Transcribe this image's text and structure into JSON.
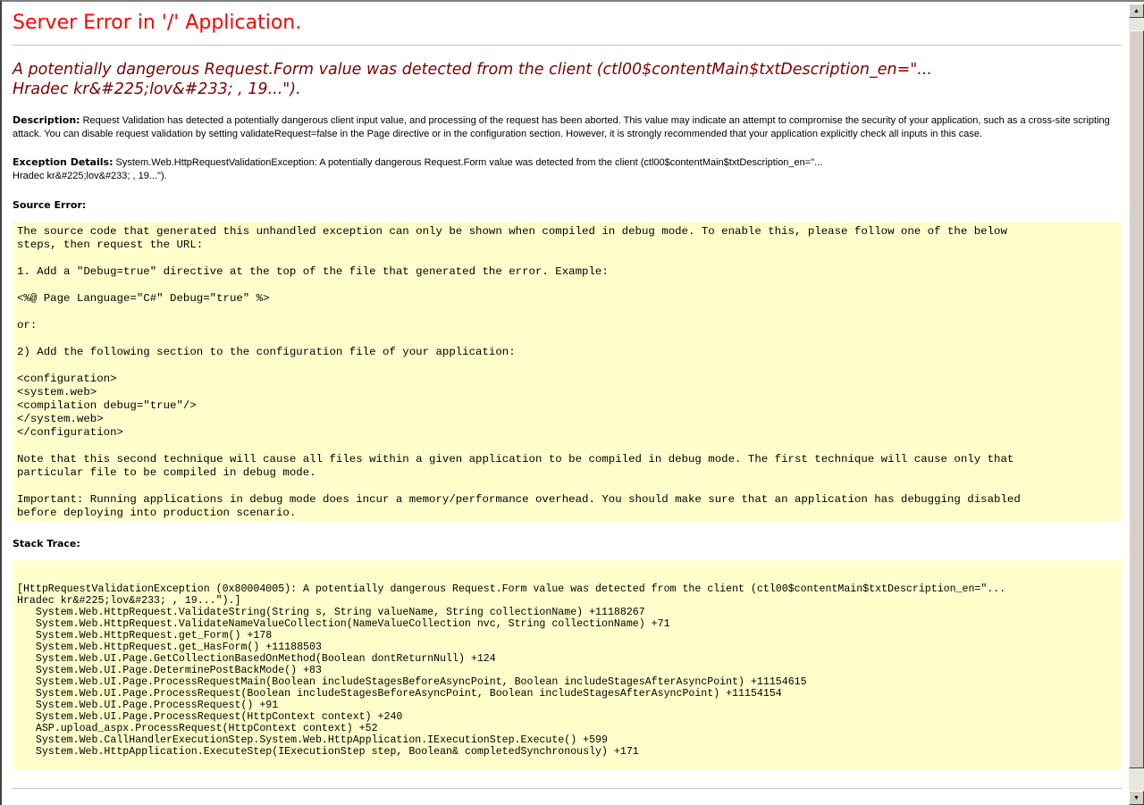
{
  "title": "Server Error in '/' Application.",
  "subtitle_line1": "A potentially dangerous Request.Form value was detected from the client (ctl00$contentMain$txtDescription_en=\"...",
  "subtitle_line2": "Hradec kr&#225;lov&#233; , 19...\").",
  "description": {
    "label": "Description:",
    "text": " Request Validation has detected a potentially dangerous client input value, and processing of the request has been aborted. This value may indicate an attempt to compromise the security of your application, such as a cross-site scripting attack. You can disable request validation by setting validateRequest=false in the Page directive or in the configuration section. However, it is strongly recommended that your application explicitly check all inputs in this case."
  },
  "exception": {
    "label": "Exception Details:",
    "line1": " System.Web.HttpRequestValidationException: A potentially dangerous Request.Form value was detected from the client (ctl00$contentMain$txtDescription_en=\"...",
    "line2": "Hradec kr&#225;lov&#233; , 19...\")."
  },
  "source_error": {
    "label": "Source Error:",
    "text": "The source code that generated this unhandled exception can only be shown when compiled in debug mode. To enable this, please follow one of the below\nsteps, then request the URL:\n\n1. Add a \"Debug=true\" directive at the top of the file that generated the error. Example:\n\n<%@ Page Language=\"C#\" Debug=\"true\" %>\n\nor:\n\n2) Add the following section to the configuration file of your application:\n\n<configuration>\n<system.web>\n<compilation debug=\"true\"/>\n</system.web>\n</configuration>\n\nNote that this second technique will cause all files within a given application to be compiled in debug mode. The first technique will cause only that\nparticular file to be compiled in debug mode.\n\nImportant: Running applications in debug mode does incur a memory/performance overhead. You should make sure that an application has debugging disabled\nbefore deploying into production scenario."
  },
  "stack_trace": {
    "label": "Stack Trace:",
    "text": "[HttpRequestValidationException (0x80004005): A potentially dangerous Request.Form value was detected from the client (ctl00$contentMain$txtDescription_en=\"...\nHradec kr&#225;lov&#233; , 19...\").]\n   System.Web.HttpRequest.ValidateString(String s, String valueName, String collectionName) +11188267\n   System.Web.HttpRequest.ValidateNameValueCollection(NameValueCollection nvc, String collectionName) +71\n   System.Web.HttpRequest.get_Form() +178\n   System.Web.HttpRequest.get_HasForm() +11188503\n   System.Web.UI.Page.GetCollectionBasedOnMethod(Boolean dontReturnNull) +124\n   System.Web.UI.Page.DeterminePostBackMode() +83\n   System.Web.UI.Page.ProcessRequestMain(Boolean includeStagesBeforeAsyncPoint, Boolean includeStagesAfterAsyncPoint) +11154615\n   System.Web.UI.Page.ProcessRequest(Boolean includeStagesBeforeAsyncPoint, Boolean includeStagesAfterAsyncPoint) +11154154\n   System.Web.UI.Page.ProcessRequest() +91\n   System.Web.UI.Page.ProcessRequest(HttpContext context) +240\n   ASP.upload_aspx.ProcessRequest(HttpContext context) +52\n   System.Web.CallHandlerExecutionStep.System.Web.HttpApplication.IExecutionStep.Execute() +599\n   System.Web.HttpApplication.ExecuteStep(IExecutionStep step, Boolean& completedSynchronously) +171"
  },
  "scrollbar": {
    "up_glyph": "▲",
    "down_glyph": "▼"
  }
}
